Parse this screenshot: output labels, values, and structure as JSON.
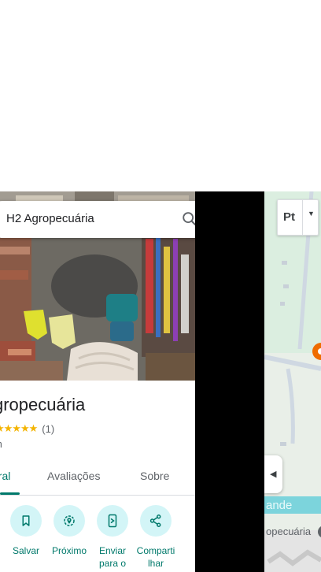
{
  "search": {
    "query": "H2 Agropecuária"
  },
  "place": {
    "title": "gropecuária",
    "stars": "★★★★★",
    "rating_count": "(1)",
    "distance": "m"
  },
  "tabs": [
    {
      "label": "eral"
    },
    {
      "label": "Avaliações"
    },
    {
      "label": "Sobre"
    }
  ],
  "actions": [
    {
      "label": "Salvar",
      "icon": "bookmark-icon"
    },
    {
      "label": "Próximo",
      "icon": "nearby-icon"
    },
    {
      "label": "Enviar para o",
      "icon": "send-to-phone-icon"
    },
    {
      "label": "Comparti lhar",
      "icon": "share-icon"
    }
  ],
  "map": {
    "layers_label": "Pt",
    "road_label": "ande",
    "place_label": "opecuária"
  },
  "colors": {
    "accent": "#00796b",
    "action_bg": "#d3f5f7",
    "star": "#f4b400",
    "water": "#7cd4dc",
    "park": "#dbeee0",
    "marker": "#ef6c00"
  }
}
